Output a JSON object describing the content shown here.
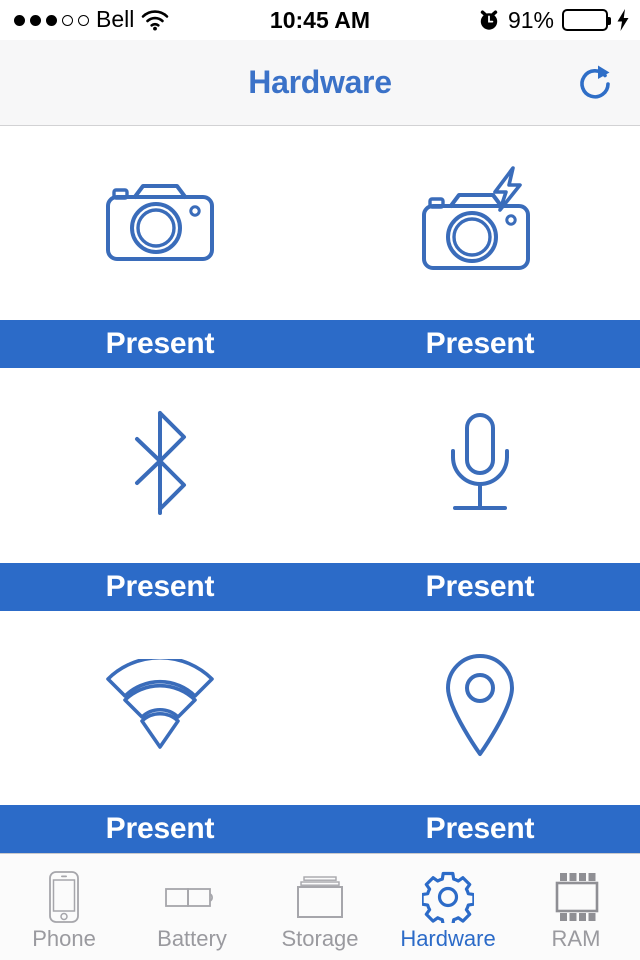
{
  "status_bar": {
    "carrier": "Bell",
    "signal_dots_filled": 3,
    "signal_dots_total": 5,
    "wifi_icon": "wifi-icon",
    "time": "10:45 AM",
    "alarm_icon": "alarm-clock-icon",
    "battery_percent": "91%",
    "battery_color": "#4CD964",
    "charging_icon": "lightning-bolt-icon"
  },
  "nav": {
    "title": "Hardware",
    "title_color": "#3b72c8",
    "refresh_icon": "refresh-icon"
  },
  "theme": {
    "accent": "#2c6bc8",
    "status_band_bg": "#2c6bc8",
    "status_band_text": "#ffffff",
    "inactive_tab": "#9a9a9f"
  },
  "hardware_items": [
    {
      "icon": "camera-icon",
      "name": "Camera",
      "status": "Present"
    },
    {
      "icon": "camera-flash-icon",
      "name": "Camera Flash",
      "status": "Present"
    },
    {
      "icon": "bluetooth-icon",
      "name": "Bluetooth",
      "status": "Present"
    },
    {
      "icon": "microphone-icon",
      "name": "Microphone",
      "status": "Present"
    },
    {
      "icon": "wifi-fan-icon",
      "name": "Wi-Fi",
      "status": "Present"
    },
    {
      "icon": "location-pin-icon",
      "name": "Location",
      "status": "Present"
    }
  ],
  "tabs": [
    {
      "label": "Phone",
      "icon": "phone-icon",
      "active": false
    },
    {
      "label": "Battery",
      "icon": "battery-icon",
      "active": false
    },
    {
      "label": "Storage",
      "icon": "storage-icon",
      "active": false
    },
    {
      "label": "Hardware",
      "icon": "gear-icon",
      "active": true
    },
    {
      "label": "RAM",
      "icon": "ram-chip-icon",
      "active": false
    }
  ]
}
